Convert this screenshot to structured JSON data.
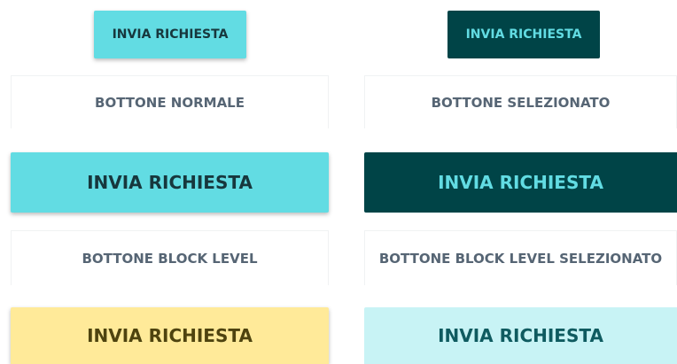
{
  "colors": {
    "primary_light": "#62dce3",
    "primary_dark": "#004447",
    "warning_light": "#ffea99",
    "info_light": "#c8f3f5",
    "caption_text": "#566574"
  },
  "buttons": {
    "small_normal": "INVIA RICHIESTA",
    "small_selected": "INVIA RICHIESTA",
    "block_normal": "INVIA RICHIESTA",
    "block_selected": "INVIA RICHIESTA",
    "block_yellow": "INVIA RICHIESTA",
    "block_pale": "INVIA RICHIESTA"
  },
  "captions": {
    "normal": "BOTTONE NORMALE",
    "selected": "BOTTONE SELEZIONATO",
    "block_level": "BOTTONE BLOCK LEVEL",
    "block_level_selected": "BOTTONE BLOCK LEVEL SELEZIONATO"
  }
}
